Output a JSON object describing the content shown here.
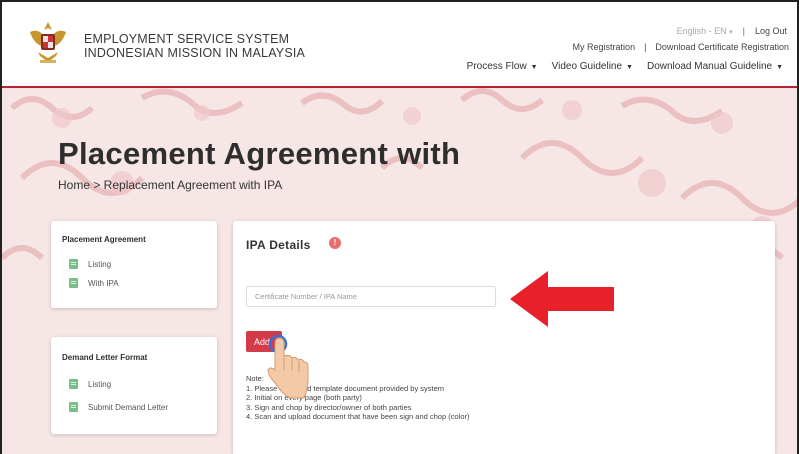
{
  "header": {
    "brand_line1": "EMPLOYMENT SERVICE SYSTEM",
    "brand_line2": "INDONESIAN MISSION IN MALAYSIA",
    "language": "English - EN",
    "logout": "Log Out",
    "my_registration": "My Registration",
    "download_certificate": "Download Certificate Registration",
    "nav": [
      {
        "label": "Process Flow"
      },
      {
        "label": "Video Guideline"
      },
      {
        "label": "Download Manual Guideline"
      }
    ]
  },
  "page": {
    "title": "Placement Agreement with",
    "breadcrumb": "Home > Replacement Agreement with IPA"
  },
  "sidebar": {
    "section1": {
      "title": "Placement Agreement",
      "items": [
        {
          "label": "Listing"
        },
        {
          "label": "With IPA"
        }
      ]
    },
    "section2": {
      "title": "Demand Letter Format",
      "items": [
        {
          "label": "Listing"
        },
        {
          "label": "Submit Demand Letter"
        }
      ]
    }
  },
  "ipa_panel": {
    "title": "IPA Details",
    "info_icon": "!",
    "input_placeholder": "Certificate Number / IPA Name",
    "input_value": "",
    "add_button": "Add",
    "notes_heading": "Note:",
    "notes": [
      "1. Please download template document provided by system",
      "2. Initial on every page (both party)",
      "3. Sign and chop by director/owner of both parties",
      "4. Scan and upload document that have been sign and chop (color)"
    ]
  },
  "colors": {
    "accent": "#d43b49",
    "annotation_arrow": "#e8202a",
    "header_border": "#b8232f"
  },
  "icons": {
    "info": "info-icon",
    "document": "document-icon",
    "pointer": "hand-pointer-icon",
    "arrow": "red-arrow-annotation"
  }
}
